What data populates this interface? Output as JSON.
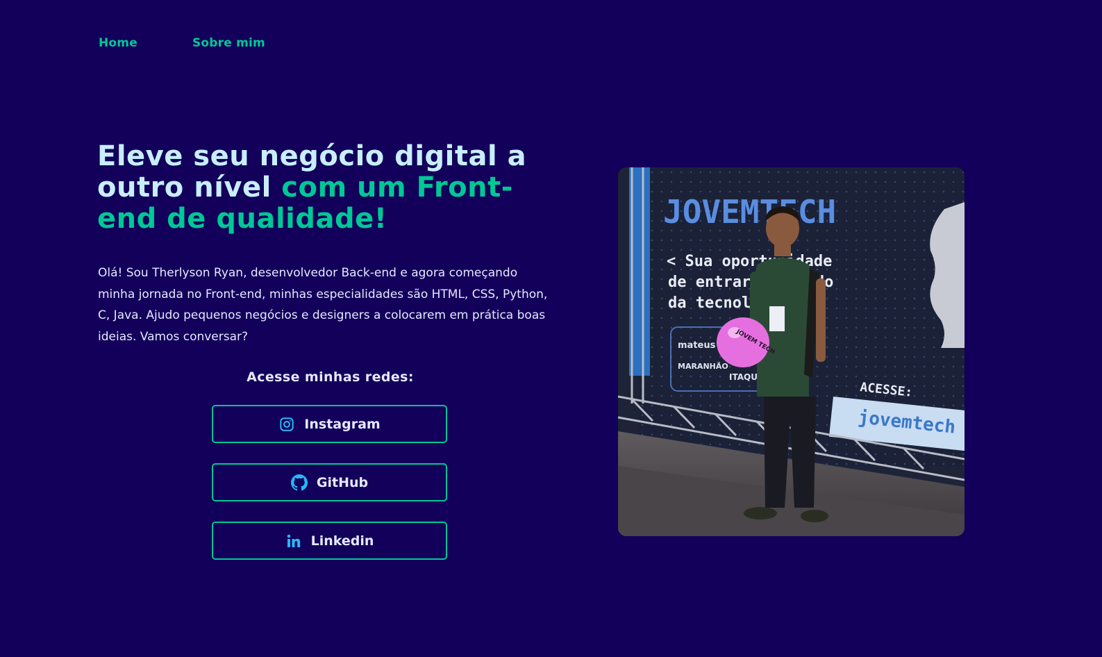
{
  "nav": {
    "items": [
      {
        "label": "Home"
      },
      {
        "label": "Sobre mim"
      }
    ]
  },
  "hero": {
    "headline_part1": "Eleve seu negócio digital a outro nível ",
    "headline_part2": "com um Front-end de qualidade!",
    "intro": "Olá! Sou Therlyson Ryan, desenvolvedor Back-end e agora começando minha jornada no Front-end, minhas especialidades são HTML, CSS, Python, C, Java. Ajudo pequenos negócios e designers a colocarem em prática boas ideias. Vamos conversar?"
  },
  "social": {
    "title": "Acesse minhas redes:",
    "links": [
      {
        "label": "Instagram",
        "icon": "instagram-icon"
      },
      {
        "label": "GitHub",
        "icon": "github-icon"
      },
      {
        "label": "Linkedin",
        "icon": "linkedin-icon"
      }
    ]
  },
  "photo": {
    "banner_brand": "JOVEMTECH",
    "banner_line1": "< Sua oportunidade",
    "banner_line2": "de entrar no mundo",
    "banner_line3": "da tecnologia",
    "banner_sponsor1": "mateus",
    "banner_sponsor2": "MARANHÃO",
    "banner_sponsor3": "ITAQUI",
    "banner_access": "ACESSE:",
    "banner_url": "jovemtech",
    "balloon_text": "JOVEM TECH"
  },
  "colors": {
    "background": "#13005a",
    "accent": "#00c896",
    "headline": "#c8eefe",
    "text": "#e6e8ff",
    "icon": "#29b6f6"
  }
}
